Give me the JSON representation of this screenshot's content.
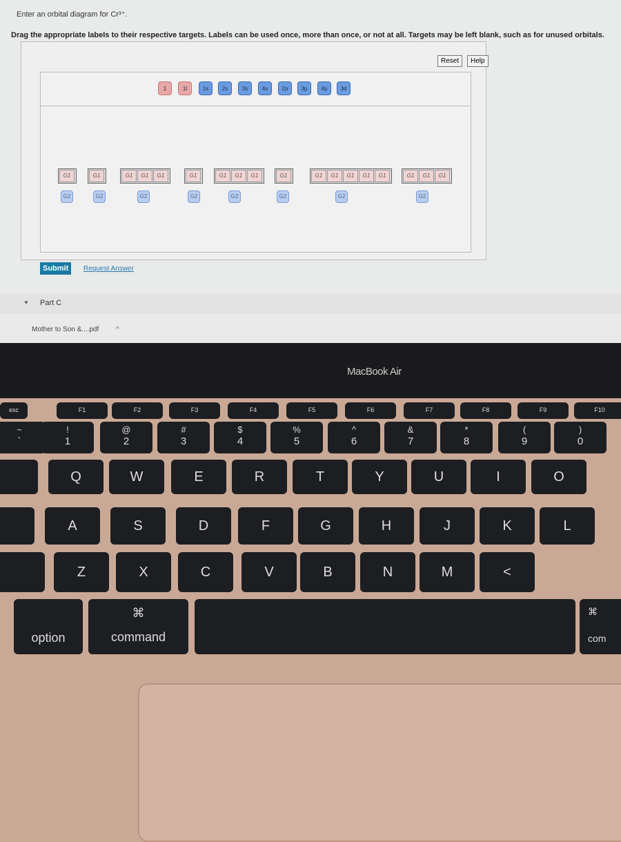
{
  "question": {
    "prompt": "Enter an orbital diagram for Cr³⁺.",
    "instructions": "Drag the appropriate labels to their respective targets. Labels can be used once, more than once, or not at all. Targets may be left blank, such as for unused orbitals."
  },
  "toolbar": {
    "reset": "Reset",
    "help": "Help"
  },
  "label_bank": {
    "arrows": [
      "1",
      "1l"
    ],
    "orbitals": [
      "1s",
      "2s",
      "3s",
      "4s",
      "2p",
      "3p",
      "4p",
      "3d"
    ]
  },
  "targets": {
    "g1": "G1",
    "g2": "G2",
    "groups": [
      1,
      1,
      3,
      1,
      3,
      1,
      5,
      3
    ]
  },
  "actions": {
    "submit": "Submit",
    "request_answer": "Request Answer"
  },
  "part": {
    "label": "Part C"
  },
  "download": {
    "file": "Mother to Son &....pdf",
    "chevron": "^"
  },
  "laptop": {
    "brand": "MacBook Air"
  },
  "keyboard": {
    "fn": [
      "esc",
      "F1",
      "F2",
      "F3",
      "F4",
      "F5",
      "F6",
      "F7",
      "F8",
      "F9",
      "F10"
    ],
    "num": [
      [
        "~",
        "`"
      ],
      [
        "!",
        "1"
      ],
      [
        "@",
        "2"
      ],
      [
        "#",
        "3"
      ],
      [
        "$",
        "4"
      ],
      [
        "%",
        "5"
      ],
      [
        "^",
        "6"
      ],
      [
        "&",
        "7"
      ],
      [
        "*",
        "8"
      ],
      [
        "(",
        "9"
      ],
      [
        ")",
        "0"
      ]
    ],
    "qwerty": [
      "Q",
      "W",
      "E",
      "R",
      "T",
      "Y",
      "U",
      "I",
      "O"
    ],
    "asdf": [
      "A",
      "S",
      "D",
      "F",
      "G",
      "H",
      "J",
      "K",
      "L"
    ],
    "zxcv": [
      "Z",
      "X",
      "C",
      "V",
      "B",
      "N",
      "M",
      "<"
    ],
    "option": "option",
    "command": "command",
    "command_symbol": "⌘",
    "command_right": "com"
  },
  "colors": {
    "submit": "#1a7aa3",
    "label_arrow": "#e8a7a7",
    "label_orbital": "#6b9be0"
  }
}
